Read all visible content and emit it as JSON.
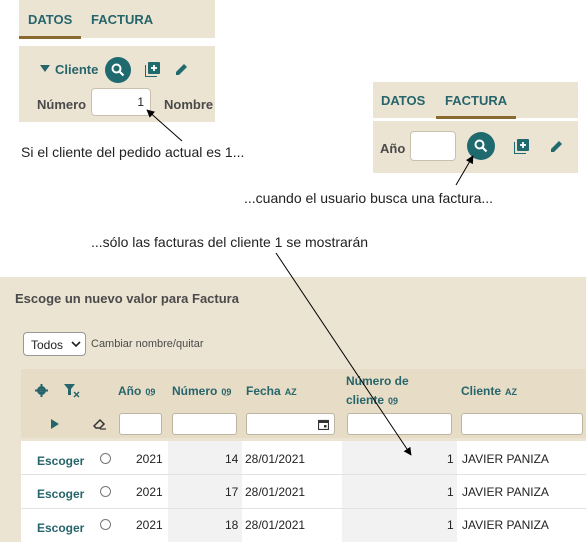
{
  "widget1": {
    "tabs": [
      "DATOS",
      "FACTURA"
    ],
    "section_label": "Cliente",
    "numero_label": "Número",
    "numero_value": "1",
    "nombre_label": "Nombre"
  },
  "widget2": {
    "tabs": [
      "DATOS",
      "FACTURA"
    ],
    "anio_label": "Año"
  },
  "captions": {
    "c1": "Si el cliente del pedido actual es 1...",
    "c2": "...cuando el usuario busca una factura...",
    "c3": "...sólo las facturas del cliente 1 se mostrarán"
  },
  "dialog": {
    "title": "Escoge un nuevo valor para Factura",
    "select_value": "Todos",
    "rename_label": "Cambiar nombre/quitar",
    "columns": [
      "Año",
      "Número",
      "Fecha",
      "Número de cliente",
      "Cliente"
    ],
    "pick_label": "Escoger",
    "rows": [
      {
        "anio": "2021",
        "numero": "14",
        "fecha": "28/01/2021",
        "num_cliente": "1",
        "cliente": "JAVIER PANIZA"
      },
      {
        "anio": "2021",
        "numero": "17",
        "fecha": "28/01/2021",
        "num_cliente": "1",
        "cliente": "JAVIER PANIZA"
      },
      {
        "anio": "2021",
        "numero": "18",
        "fecha": "28/01/2021",
        "num_cliente": "1",
        "cliente": "JAVIER PANIZA"
      }
    ]
  },
  "colors": {
    "accent": "#1f6a6e",
    "panel": "#ece4d3",
    "tab_underline": "#8a6a2e"
  }
}
